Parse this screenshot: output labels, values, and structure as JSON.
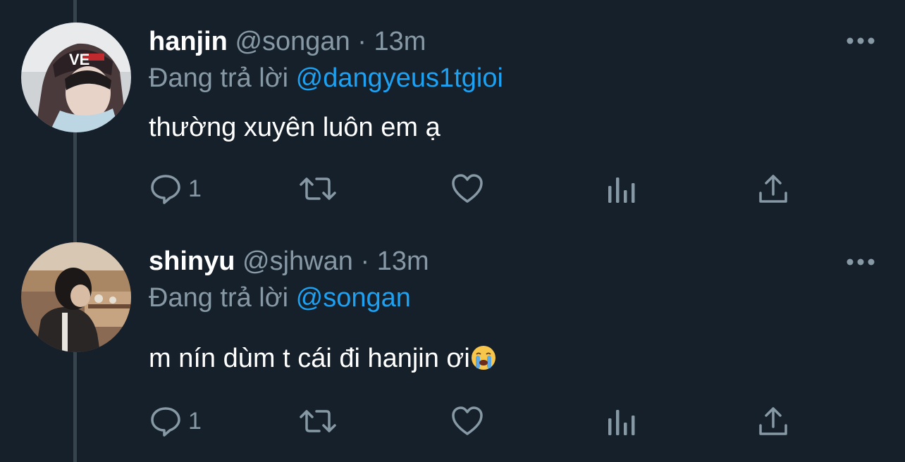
{
  "tweets": [
    {
      "name": "hanjin",
      "handle": "@songan",
      "separator": "·",
      "time": "13m",
      "reply_prefix": "Đang trả lời",
      "reply_to": "@dangyeus1tgioi",
      "text": "thường xuyên luôn em ạ",
      "reply_count": "1"
    },
    {
      "name": "shinyu",
      "handle": "@sjhwan",
      "separator": "·",
      "time": "13m",
      "reply_prefix": "Đang trả lời",
      "reply_to": "@songan",
      "text": "m nín dùm t cái đi hanjin ơi",
      "reply_count": "1"
    }
  ],
  "colors": {
    "background": "#15202b",
    "secondary_text": "#8899a6",
    "link": "#1da1f2",
    "thread_line": "#38444d"
  },
  "icons": [
    "reply-icon",
    "retweet-icon",
    "like-icon",
    "stats-icon",
    "share-icon",
    "more-icon",
    "crying-face-emoji"
  ]
}
